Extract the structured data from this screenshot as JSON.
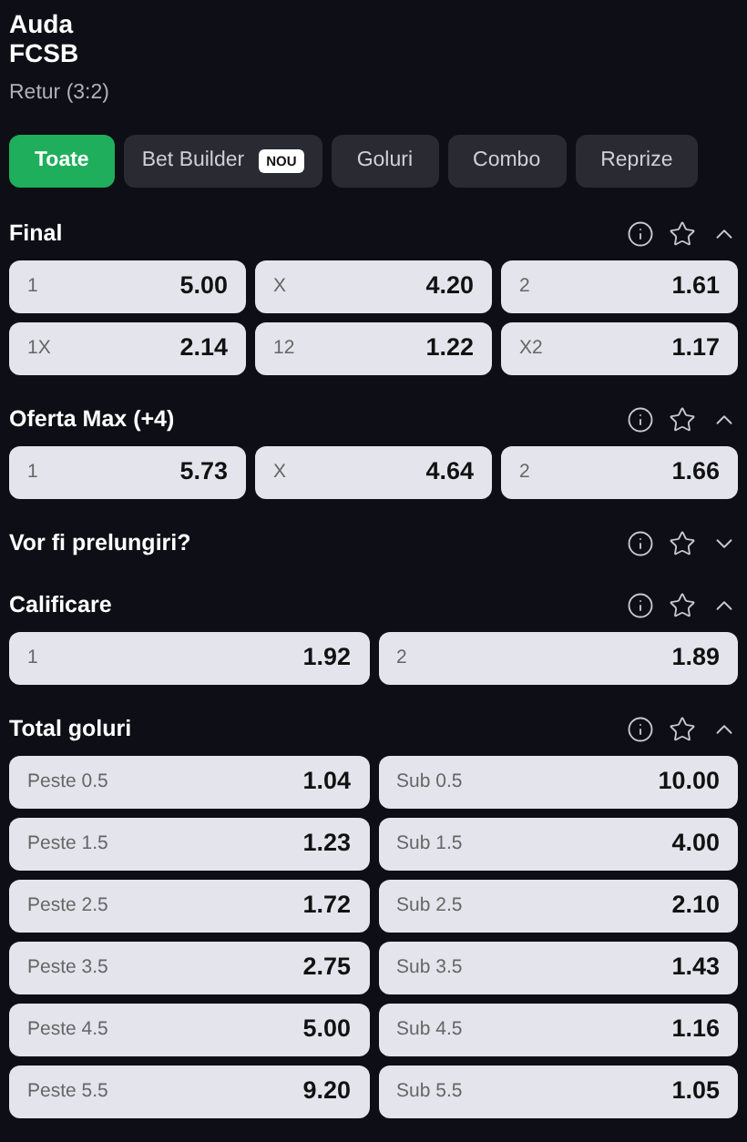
{
  "match": {
    "teams": [
      "Auda",
      "FCSB"
    ],
    "subtitle": "Retur (3:2)"
  },
  "tabs": [
    {
      "label": "Toate",
      "selected": true
    },
    {
      "label": "Bet Builder",
      "selected": false,
      "badge": "NOU"
    },
    {
      "label": "Goluri",
      "selected": false
    },
    {
      "label": "Combo",
      "selected": false
    },
    {
      "label": "Reprize",
      "selected": false
    }
  ],
  "markets": [
    {
      "title": "Final",
      "expanded": true,
      "rows": [
        [
          {
            "label": "1",
            "odd": "5.00"
          },
          {
            "label": "X",
            "odd": "4.20"
          },
          {
            "label": "2",
            "odd": "1.61"
          }
        ],
        [
          {
            "label": "1X",
            "odd": "2.14"
          },
          {
            "label": "12",
            "odd": "1.22"
          },
          {
            "label": "X2",
            "odd": "1.17"
          }
        ]
      ]
    },
    {
      "title": "Oferta Max (+4)",
      "expanded": true,
      "rows": [
        [
          {
            "label": "1",
            "odd": "5.73"
          },
          {
            "label": "X",
            "odd": "4.64"
          },
          {
            "label": "2",
            "odd": "1.66"
          }
        ]
      ]
    },
    {
      "title": "Vor fi prelungiri?",
      "expanded": false
    },
    {
      "title": "Calificare",
      "expanded": true,
      "rows": [
        [
          {
            "label": "1",
            "odd": "1.92"
          },
          {
            "label": "2",
            "odd": "1.89"
          }
        ]
      ]
    },
    {
      "title": "Total goluri",
      "expanded": true,
      "rows": [
        [
          {
            "label": "Peste 0.5",
            "odd": "1.04"
          },
          {
            "label": "Sub 0.5",
            "odd": "10.00"
          }
        ],
        [
          {
            "label": "Peste 1.5",
            "odd": "1.23"
          },
          {
            "label": "Sub 1.5",
            "odd": "4.00"
          }
        ],
        [
          {
            "label": "Peste 2.5",
            "odd": "1.72"
          },
          {
            "label": "Sub 2.5",
            "odd": "2.10"
          }
        ],
        [
          {
            "label": "Peste 3.5",
            "odd": "2.75"
          },
          {
            "label": "Sub 3.5",
            "odd": "1.43"
          }
        ],
        [
          {
            "label": "Peste 4.5",
            "odd": "5.00"
          },
          {
            "label": "Sub 4.5",
            "odd": "1.16"
          }
        ],
        [
          {
            "label": "Peste 5.5",
            "odd": "9.20"
          },
          {
            "label": "Sub 5.5",
            "odd": "1.05"
          }
        ]
      ]
    }
  ]
}
